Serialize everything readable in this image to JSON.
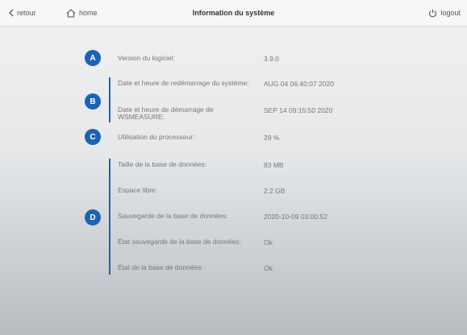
{
  "header": {
    "back_label": "retour",
    "home_label": "home",
    "title": "Information du système",
    "logout_label": "logout"
  },
  "badges": {
    "a": "A",
    "b": "B",
    "c": "C",
    "d": "D"
  },
  "info": {
    "software_version": {
      "label": "Version du logiciel:",
      "value": "3.9.0"
    },
    "system_restart": {
      "label": "Date et heure de redémarrage du système:",
      "value": "AUG 04 06:40:07 2020"
    },
    "wsmeasure_start": {
      "label": "Date et heure de démarrage de WSMEASURE:",
      "value": "SEP 14 09:15:50 2020"
    },
    "cpu_usage": {
      "label": "Utilisation du processeur:",
      "value": "29 %"
    },
    "db_size": {
      "label": "Taille de la base de données:",
      "value": "83 MB"
    },
    "free_space": {
      "label": "Espace libre:",
      "value": "2.2 GB"
    },
    "db_backup": {
      "label": "Sauvegarde de la base de données:",
      "value": "2020-10-09 03:00:52"
    },
    "backup_status": {
      "label": "État sauvegarde de la base de données:",
      "value": "Ok"
    },
    "db_status": {
      "label": "État de la base de données:",
      "value": "Ok"
    }
  },
  "icons": [
    "chevron-left-icon",
    "home-icon",
    "power-icon"
  ],
  "colors": {
    "accent": "#1a63b7",
    "topbar": "#f7f7f8"
  }
}
